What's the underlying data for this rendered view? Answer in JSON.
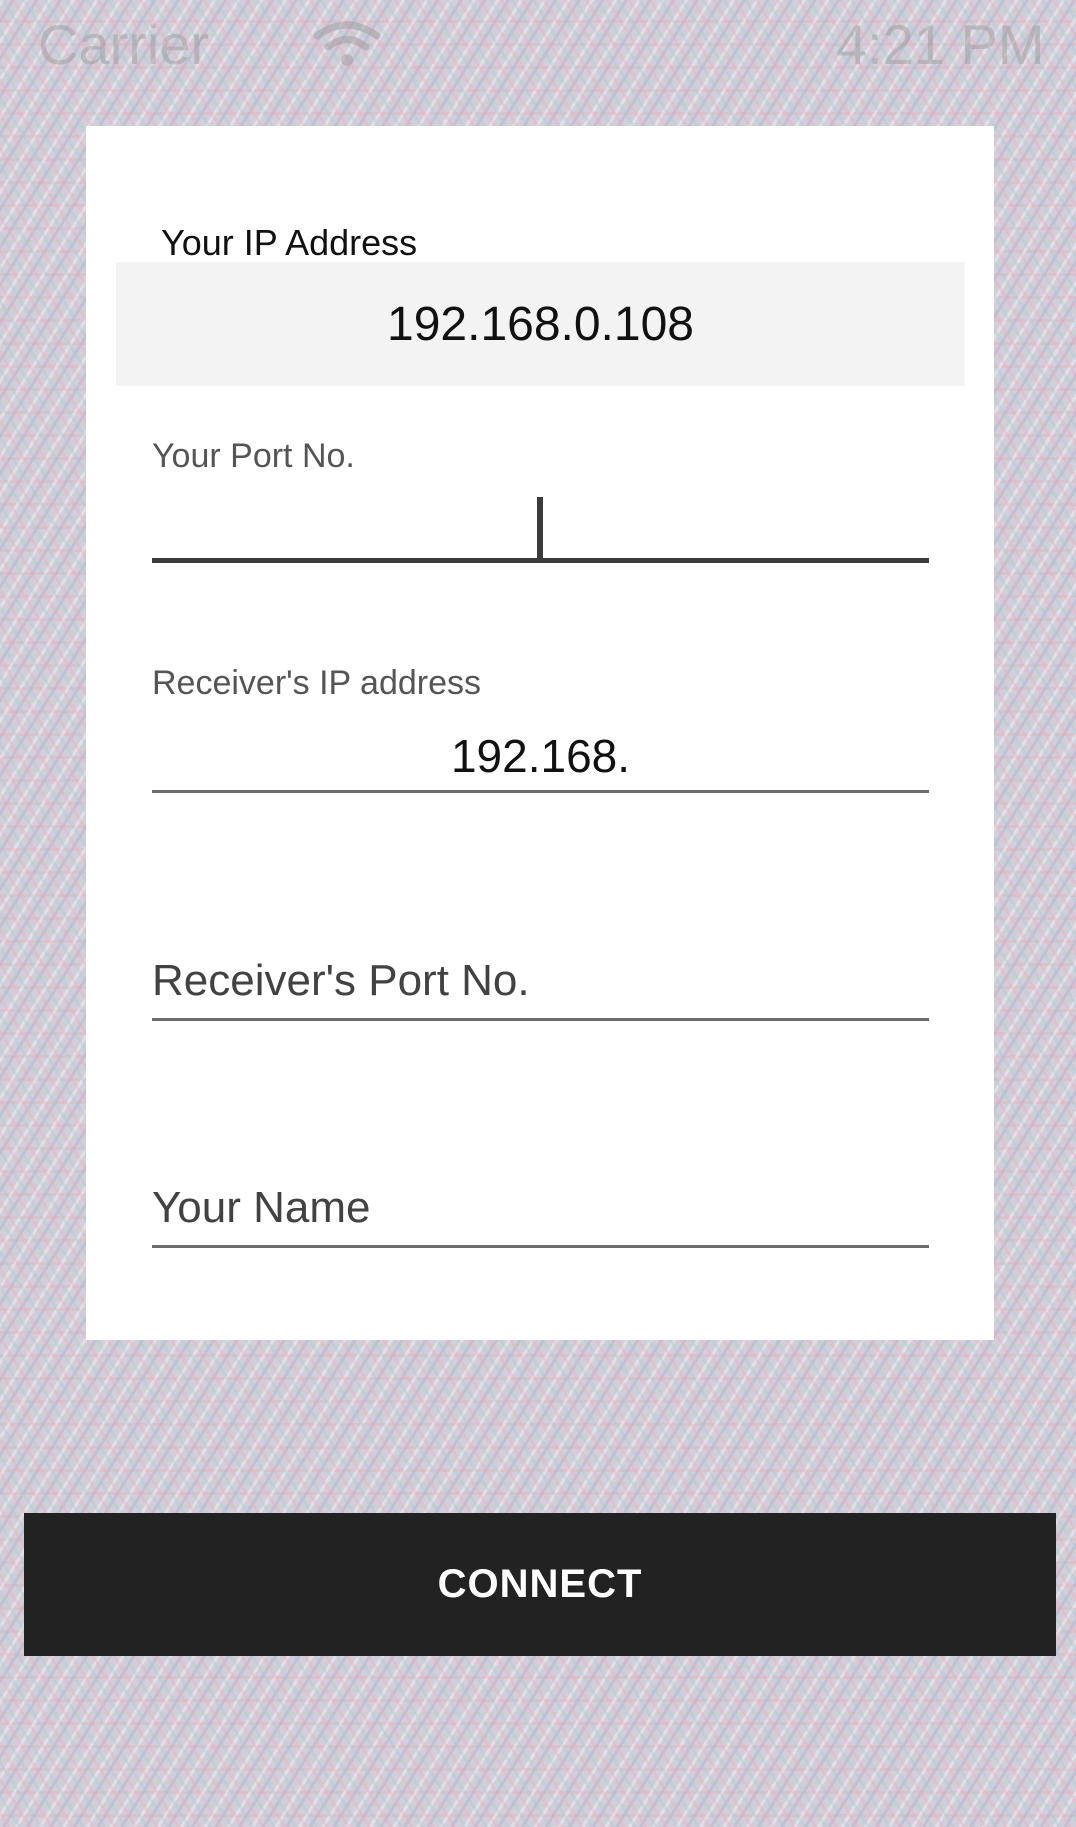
{
  "status_bar": {
    "carrier": "Carrier",
    "time": "4:21 PM",
    "wifi_icon": "wifi-icon"
  },
  "form": {
    "your_ip_label": "Your IP Address",
    "your_ip_value": "192.168.0.108",
    "your_port_label": "Your Port No.",
    "your_port_value": "",
    "receiver_ip_label": "Receiver's IP address",
    "receiver_ip_value": "192.168.",
    "receiver_port_placeholder": "Receiver's Port No.",
    "your_name_placeholder": "Your Name"
  },
  "actions": {
    "connect_label": "CONNECT"
  },
  "colors": {
    "card_background": "#ffffff",
    "ip_box_background": "#f3f3f3",
    "button_background": "#222222",
    "button_text": "#ffffff",
    "underline": "#6b6b6b"
  }
}
